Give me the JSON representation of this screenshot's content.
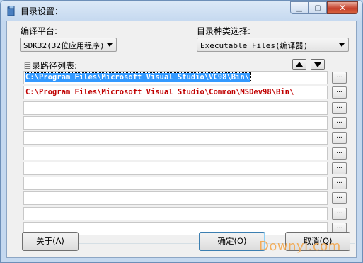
{
  "window": {
    "title": "目录设置："
  },
  "platform": {
    "label": "编译平台:",
    "value": "SDK32(32位应用程序)"
  },
  "category": {
    "label": "目录种类选择:",
    "value": "Executable Files(编译器)"
  },
  "paths": {
    "label": "目录路径列表:",
    "rows": [
      "C:\\Program Files\\Microsoft Visual Studio\\VC98\\Bin\\",
      "C:\\Program Files\\Microsoft Visual Studio\\Common\\MSDev98\\Bin\\",
      "",
      "",
      "",
      "",
      "",
      "",
      "",
      "",
      ""
    ],
    "browse_label": "..."
  },
  "buttons": {
    "about": "关于(A)",
    "ok": "确定(O)",
    "cancel": "取消(Q)"
  },
  "watermark": "Downyi.com",
  "colors": {
    "path_text": "#c00000",
    "selection": "#3399ff",
    "watermark": "#f3a74d"
  }
}
